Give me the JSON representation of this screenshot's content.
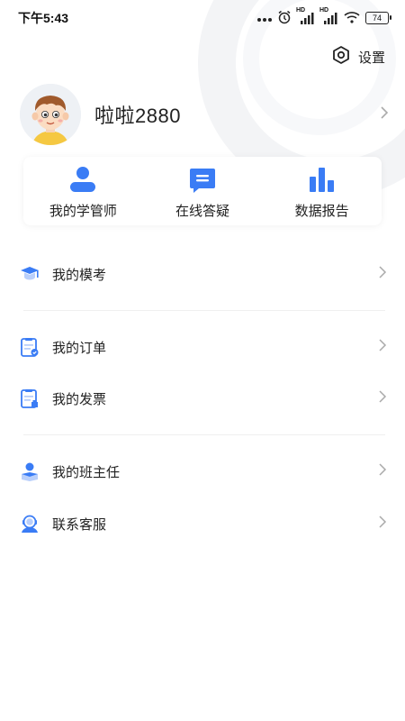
{
  "status_bar": {
    "time": "下午5:43",
    "battery": "74",
    "signal_label_1": "HD",
    "signal_label_2": "HD"
  },
  "settings": {
    "label": "设置",
    "icon": "settings-hexagon-icon"
  },
  "profile": {
    "username": "啦啦2880",
    "avatar_icon": "cartoon-boy-avatar"
  },
  "quick_actions": [
    {
      "label": "我的学管师",
      "icon": "person-icon"
    },
    {
      "label": "在线答疑",
      "icon": "chat-bubble-icon"
    },
    {
      "label": "数据报告",
      "icon": "bar-chart-icon"
    }
  ],
  "menu": [
    {
      "label": "我的模考",
      "icon": "graduation-cap-icon"
    },
    {
      "label": "我的订单",
      "icon": "order-list-icon"
    },
    {
      "label": "我的发票",
      "icon": "invoice-icon"
    },
    {
      "label": "我的班主任",
      "icon": "teacher-icon"
    },
    {
      "label": "联系客服",
      "icon": "customer-service-icon"
    }
  ],
  "colors": {
    "accent": "#3a7cf5",
    "accent_light": "#b9cffb",
    "chevron": "#aaaaaa"
  }
}
